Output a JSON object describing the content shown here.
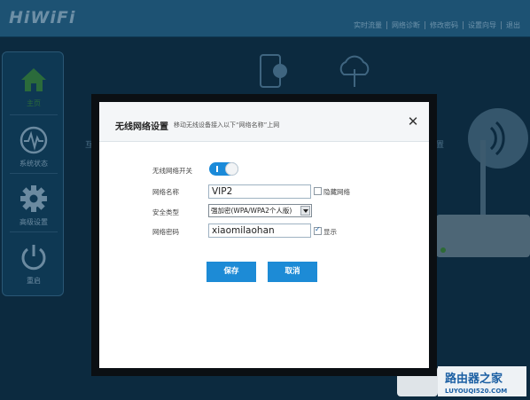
{
  "app": {
    "logo_text": "HiWiFi"
  },
  "topnav": {
    "items": [
      "实时流量",
      "网络诊断",
      "修改密码",
      "设置向导",
      "退出"
    ]
  },
  "sidebar": {
    "items": [
      {
        "label": "主页",
        "icon": "home-icon"
      },
      {
        "label": "系统状态",
        "icon": "pulse-icon"
      },
      {
        "label": "高级设置",
        "icon": "gear-icon"
      },
      {
        "label": "重启",
        "icon": "power-icon"
      }
    ]
  },
  "background": {
    "left_text": "互",
    "right_text": "置"
  },
  "modal": {
    "title": "无线网络设置",
    "subtitle": "移动无线设备接入以下“网络名称”上网",
    "close_glyph": "✕",
    "fields": {
      "wifi_switch_label": "无线网络开关",
      "wifi_enabled": true,
      "ssid_label": "网络名称",
      "ssid_value": "VIP2",
      "hide_network_label": "隐藏网络",
      "hide_network_checked": false,
      "security_label": "安全类型",
      "security_value": "强加密(WPA/WPA2个人版)",
      "password_label": "网络密码",
      "password_value": "xiaomilaohan",
      "show_password_label": "显示",
      "show_password_checked": true
    },
    "buttons": {
      "save": "保存",
      "cancel": "取消"
    }
  },
  "watermark": {
    "line1": "路由器之家",
    "line2": "LUYOUQI520.COM"
  },
  "colors": {
    "accent": "#1d8bd6",
    "topbar": "#1d5273",
    "overlay": "#0c2a3f"
  }
}
